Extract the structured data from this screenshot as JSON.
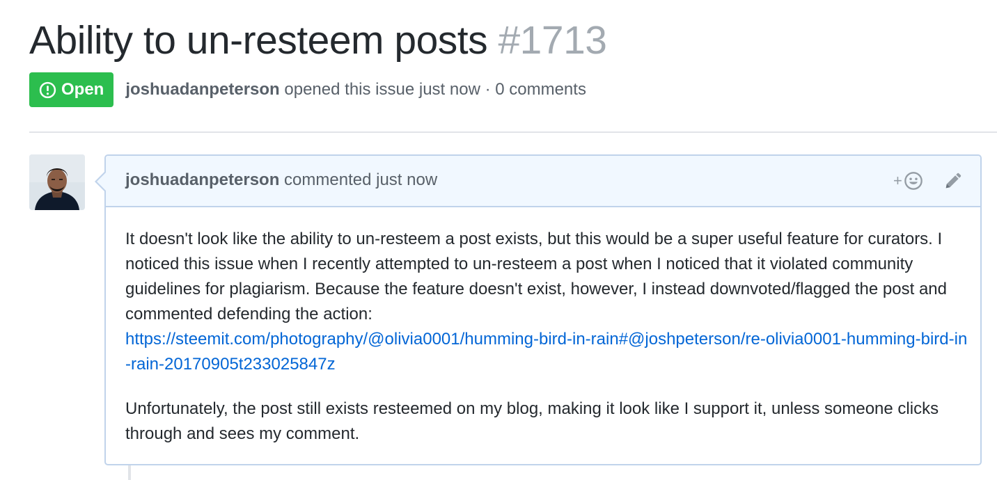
{
  "issue": {
    "title": "Ability to un-resteem posts",
    "number": "#1713",
    "state": "Open",
    "author": "joshuadanpeterson",
    "meta_suffix": "opened this issue just now · 0 comments"
  },
  "comment": {
    "author": "joshuadanpeterson",
    "action": "commented just now",
    "reaction_plus": "+",
    "body": {
      "paragraph1_text": "It doesn't look like the ability to un-resteem a post exists, but this would be a super useful feature for curators. I noticed this issue when I recently attempted to un-resteem a post when I noticed that it violated community guidelines for plagiarism. Because the feature doesn't exist, however, I instead downvoted/flagged the post and commented defending the action:",
      "link": "https://steemit.com/photography/@olivia0001/humming-bird-in-rain#@joshpeterson/re-olivia0001-humming-bird-in-rain-20170905t233025847z",
      "paragraph2": "Unfortunately, the post still exists resteemed on my blog, making it look like I support it, unless someone clicks through and sees my comment."
    }
  },
  "colors": {
    "open_badge": "#2cbe4e",
    "link": "#0366d6",
    "comment_border": "#c0d3eb",
    "comment_header_bg": "#f1f8ff"
  },
  "icons": {
    "state": "issue-opened-icon",
    "reaction": "smiley-icon",
    "edit": "pencil-icon"
  }
}
